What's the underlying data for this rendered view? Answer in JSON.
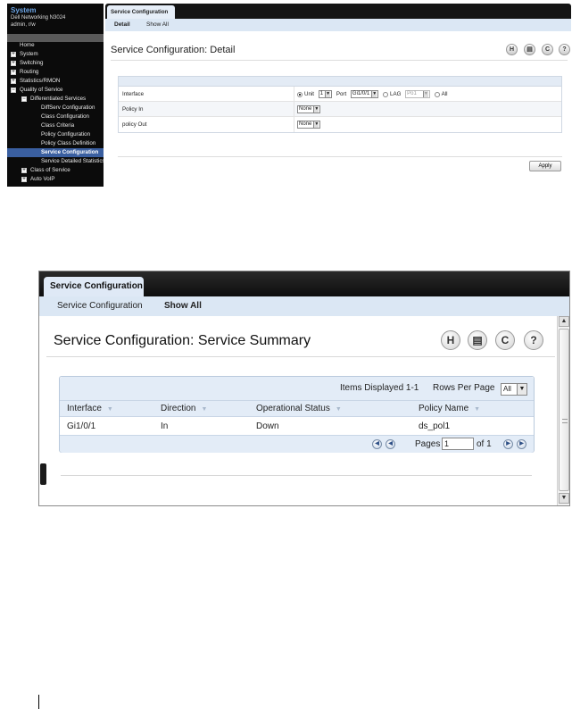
{
  "detail_screen": {
    "sidebar": {
      "system_label": "System",
      "device": "Dell Networking N3024",
      "user": "admin, r/w",
      "tree": [
        {
          "label": "Home",
          "depth": 0,
          "toggle": ""
        },
        {
          "label": "System",
          "depth": 0,
          "toggle": "+"
        },
        {
          "label": "Switching",
          "depth": 0,
          "toggle": "+"
        },
        {
          "label": "Routing",
          "depth": 0,
          "toggle": "+"
        },
        {
          "label": "Statistics/RMON",
          "depth": 0,
          "toggle": "+"
        },
        {
          "label": "Quality of Service",
          "depth": 0,
          "toggle": "-"
        },
        {
          "label": "Differentiated Services",
          "depth": 1,
          "toggle": "-"
        },
        {
          "label": "DiffServ Configuration",
          "depth": 2,
          "toggle": ""
        },
        {
          "label": "Class Configuration",
          "depth": 2,
          "toggle": ""
        },
        {
          "label": "Class Criteria",
          "depth": 2,
          "toggle": ""
        },
        {
          "label": "Policy Configuration",
          "depth": 2,
          "toggle": ""
        },
        {
          "label": "Policy Class Definition",
          "depth": 2,
          "toggle": ""
        },
        {
          "label": "Service Configuration",
          "depth": 2,
          "toggle": "",
          "selected": true
        },
        {
          "label": "Service Detailed Statistics",
          "depth": 2,
          "toggle": ""
        },
        {
          "label": "Class of Service",
          "depth": 1,
          "toggle": "+"
        },
        {
          "label": "Auto VoIP",
          "depth": 1,
          "toggle": "+"
        }
      ]
    },
    "tab": "Service Configuration",
    "subtabs": [
      "Detail",
      "Show All"
    ],
    "title": "Service Configuration: Detail",
    "toolbar_icons": [
      "save-icon",
      "print-icon",
      "refresh-icon",
      "help-icon"
    ],
    "form": {
      "interface_label": "Interface",
      "unit_label": "Unit",
      "unit_value": "1",
      "port_label": "Port",
      "port_value": "Gi1/0/1",
      "lag_label": "LAG",
      "lag_value": "Po1",
      "all_label": "All",
      "policy_in_label": "Policy In",
      "policy_in_value": "None",
      "policy_out_label": "policy Out",
      "policy_out_value": "None"
    },
    "apply_label": "Apply"
  },
  "summary_screen": {
    "tab": "Service Configuration",
    "subtabs": [
      "Service Configuration",
      "Show All"
    ],
    "title": "Service Configuration: Service Summary",
    "toolbar_icons": [
      "save-icon",
      "print-icon",
      "refresh-icon",
      "help-icon"
    ],
    "table": {
      "items_displayed": "Items Displayed 1-1",
      "rows_per_page_label": "Rows Per Page",
      "rows_per_page_value": "All",
      "columns": [
        "Interface",
        "Direction",
        "Operational Status",
        "Policy Name"
      ],
      "rows": [
        [
          "Gi1/0/1",
          "In",
          "Down",
          "ds_pol1"
        ]
      ],
      "pages_label": "Pages",
      "page_value": "1",
      "of_label": "of 1"
    }
  }
}
